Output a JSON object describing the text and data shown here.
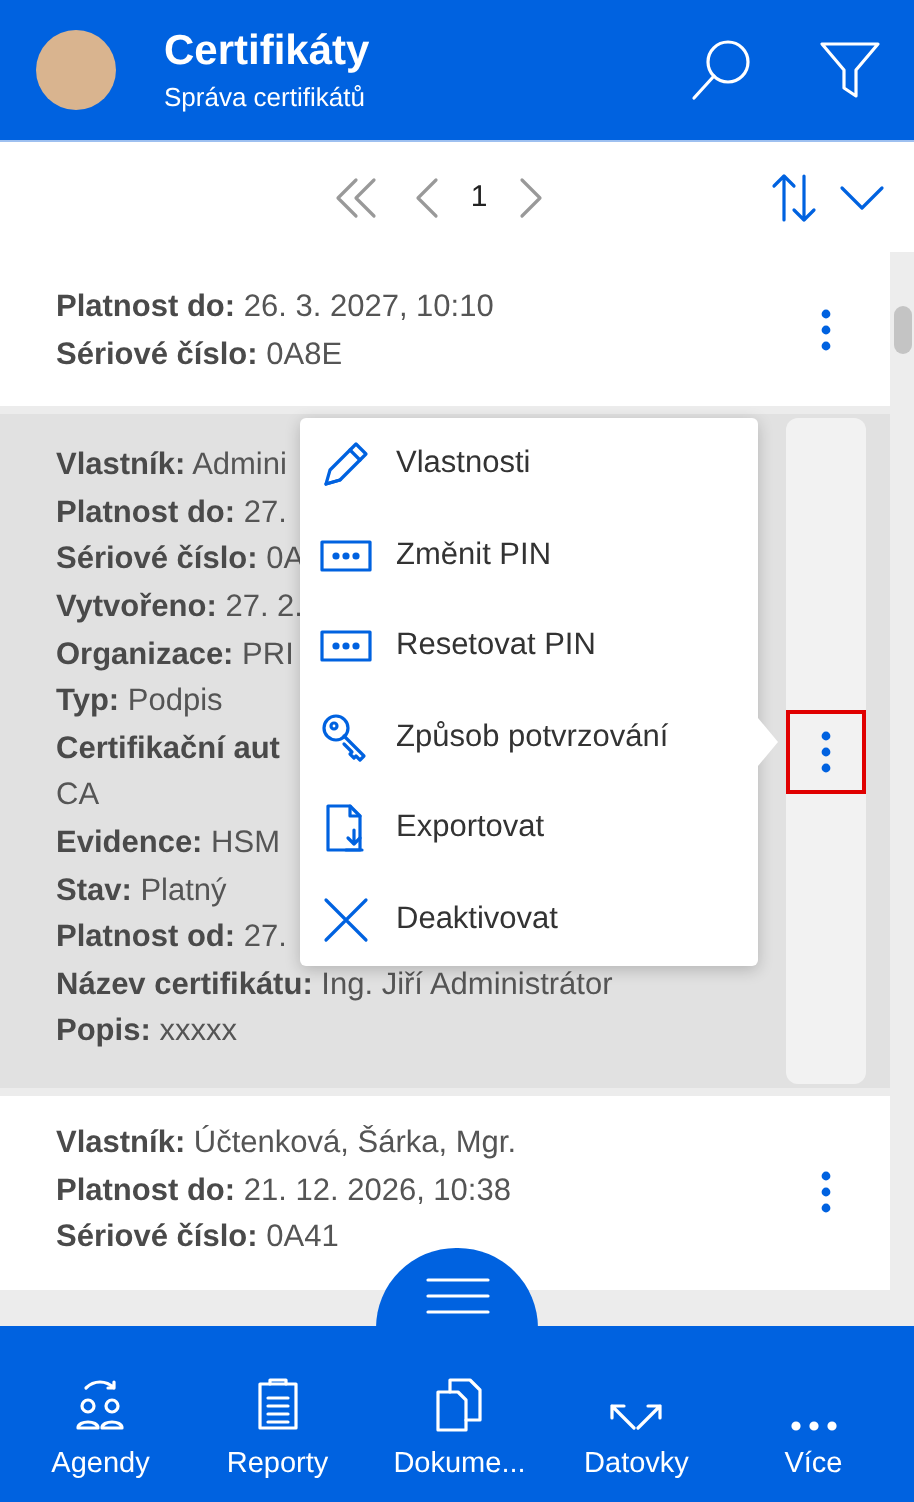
{
  "header": {
    "title": "Certifikáty",
    "subtitle": "Správa certifikátů"
  },
  "pager": {
    "page": "1"
  },
  "certificates": [
    {
      "menu_open": false,
      "fields": [
        {
          "label": "Platnost do:",
          "value": "26. 3. 2027, 10:10"
        },
        {
          "label": "Sériové číslo:",
          "value": "0A8E"
        }
      ]
    },
    {
      "menu_open": true,
      "fields": [
        {
          "label": "Vlastník:",
          "value": "Admini"
        },
        {
          "label": "Platnost do:",
          "value": "27."
        },
        {
          "label": "Sériové číslo:",
          "value": "0A"
        },
        {
          "label": "Vytvořeno:",
          "value": "27. 2."
        },
        {
          "label": "Organizace:",
          "value": "PRI"
        },
        {
          "label": "Typ:",
          "value": "Podpis"
        },
        {
          "label": "Certifikační aut"
        },
        {
          "value": "CA"
        },
        {
          "label": "Evidence:",
          "value": "HSM"
        },
        {
          "label": "Stav:",
          "value": "Platný"
        },
        {
          "label": "Platnost od:",
          "value": "27."
        },
        {
          "label": "Název certifikátu:",
          "value": "Ing. Jiří Administrátor"
        },
        {
          "label": "Popis:",
          "value": "xxxxx"
        }
      ]
    },
    {
      "menu_open": false,
      "fields": [
        {
          "label": "Vlastník:",
          "value": "Účtenková, Šárka, Mgr."
        },
        {
          "label": "Platnost do:",
          "value": "21. 12. 2026, 10:38"
        },
        {
          "label": "Sériové číslo:",
          "value": "0A41"
        }
      ]
    }
  ],
  "context_menu": [
    {
      "kind": "pencil",
      "label": "Vlastnosti"
    },
    {
      "kind": "pin",
      "label": "Změnit PIN"
    },
    {
      "kind": "pin",
      "label": "Resetovat PIN"
    },
    {
      "kind": "key",
      "label": "Způsob potvrzování"
    },
    {
      "kind": "export",
      "label": "Exportovat"
    },
    {
      "kind": "close",
      "label": "Deaktivovat"
    }
  ],
  "bottom_nav": [
    {
      "kind": "agendas",
      "label": "Agendy"
    },
    {
      "kind": "reports",
      "label": "Reporty"
    },
    {
      "kind": "documents",
      "label": "Dokume..."
    },
    {
      "kind": "mailbox",
      "label": "Datovky"
    },
    {
      "kind": "more",
      "label": "Více"
    }
  ]
}
